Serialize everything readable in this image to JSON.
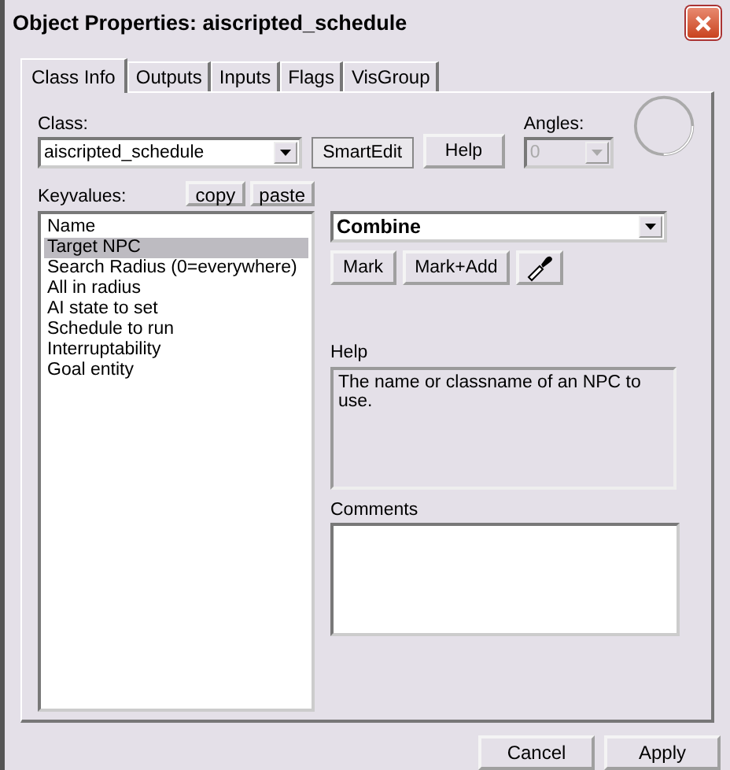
{
  "window": {
    "title": "Object Properties: aiscripted_schedule"
  },
  "tabs": [
    {
      "label": "Class Info",
      "selected": true
    },
    {
      "label": "Outputs",
      "selected": false
    },
    {
      "label": "Inputs",
      "selected": false
    },
    {
      "label": "Flags",
      "selected": false
    },
    {
      "label": "VisGroup",
      "selected": false
    }
  ],
  "class_field": {
    "label": "Class:",
    "value": "aiscripted_schedule"
  },
  "smartedit_button": {
    "label": "SmartEdit",
    "pressed": true
  },
  "help_button": {
    "label": "Help"
  },
  "angles": {
    "label": "Angles:",
    "value": "0",
    "disabled": true
  },
  "keyvalues": {
    "label": "Keyvalues:",
    "copy": "copy",
    "paste": "paste",
    "items": [
      {
        "label": "Name",
        "selected": false
      },
      {
        "label": "Target NPC",
        "selected": true
      },
      {
        "label": "Search Radius (0=everywhere)",
        "selected": false
      },
      {
        "label": "All in radius",
        "selected": false
      },
      {
        "label": "AI state to set",
        "selected": false
      },
      {
        "label": "Schedule to run",
        "selected": false
      },
      {
        "label": "Interruptability",
        "selected": false
      },
      {
        "label": "Goal entity",
        "selected": false
      }
    ]
  },
  "value_field": {
    "value": "Combine"
  },
  "mark_buttons": [
    "Mark",
    "Mark+Add"
  ],
  "help": {
    "label": "Help",
    "text": "The name or classname of an NPC to use."
  },
  "comments": {
    "label": "Comments"
  },
  "footer_buttons": [
    "Cancel",
    "Apply"
  ]
}
